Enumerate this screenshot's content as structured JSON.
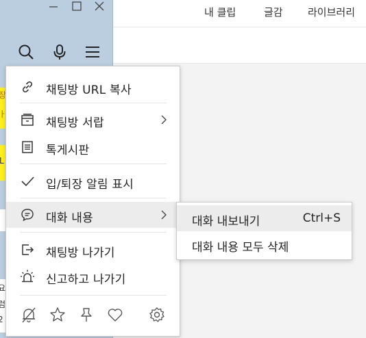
{
  "right_window": {
    "nav": [
      "내 클립",
      "글감",
      "라이브러리"
    ]
  },
  "chat_window": {
    "window_controls": [
      "minimize-icon",
      "maximize-icon",
      "close-icon"
    ],
    "toolbar_icons": [
      "search-icon",
      "microphone-icon",
      "hamburger-menu-icon"
    ],
    "side_fragments": [
      "장",
      "ㅏ",
      "L",
      "요",
      "럼",
      "2"
    ]
  },
  "context_menu": {
    "items": [
      {
        "label": "채팅방 URL 복사",
        "icon": "link-icon"
      },
      {
        "label": "채팅방 서랍",
        "icon": "drawer-icon",
        "has_submenu": true
      },
      {
        "label": "톡게시판",
        "icon": "board-icon"
      },
      {
        "label": "입/퇴장 알림 표시",
        "icon": "checkmark-icon",
        "checked": true
      },
      {
        "label": "대화 내용",
        "icon": "chat-bubble-icon",
        "has_submenu": true,
        "active": true
      },
      {
        "label": "채팅방 나가기",
        "icon": "exit-icon"
      },
      {
        "label": "신고하고 나가기",
        "icon": "siren-icon"
      }
    ],
    "footer_icons": [
      "bell-off-icon",
      "star-icon",
      "pin-icon",
      "heart-icon",
      "settings-icon"
    ]
  },
  "submenu": {
    "items": [
      {
        "label": "대화 내보내기",
        "shortcut": "Ctrl+S",
        "active": true
      },
      {
        "label": "대화 내용 모두 삭제",
        "shortcut": ""
      }
    ]
  },
  "colors": {
    "chat_bg": "#bacee0",
    "menu_bg": "#ffffff",
    "highlight": "#ececec",
    "bubble_yellow": "#fef01b"
  }
}
